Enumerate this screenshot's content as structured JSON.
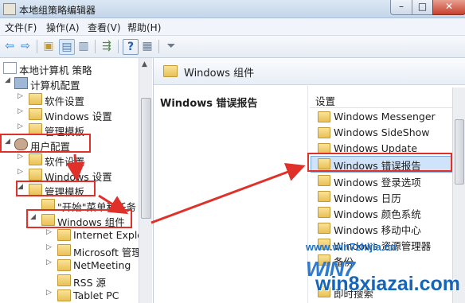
{
  "window": {
    "title": "本地组策略编辑器",
    "buttons": {
      "minimize": "–",
      "maximize": "□",
      "close": "✕"
    }
  },
  "menu": [
    "文件(F)",
    "操作(A)",
    "查看(V)",
    "帮助(H)"
  ],
  "tree": {
    "items": [
      {
        "label": "本地计算机 策略",
        "icon": "document-icon",
        "twisty": ""
      },
      {
        "label": "计算机配置",
        "icon": "computer-icon",
        "twisty": "◢"
      },
      {
        "label": "软件设置",
        "icon": "folder-icon",
        "twisty": "▷"
      },
      {
        "label": "Windows 设置",
        "icon": "folder-icon",
        "twisty": "▷"
      },
      {
        "label": "管理模板",
        "icon": "folder-icon",
        "twisty": "▷"
      },
      {
        "label": "用户配置",
        "icon": "user-icon",
        "twisty": "◢"
      },
      {
        "label": "软件设置",
        "icon": "folder-icon",
        "twisty": "▷"
      },
      {
        "label": "Windows 设置",
        "icon": "folder-icon",
        "twisty": "▷"
      },
      {
        "label": "管理模板",
        "icon": "folder-icon",
        "twisty": "◢"
      },
      {
        "label": "\"开始\"菜单和任务",
        "icon": "folder-icon",
        "twisty": ""
      },
      {
        "label": "Windows 组件",
        "icon": "folder-icon",
        "twisty": "◢"
      },
      {
        "label": "Internet Explor",
        "icon": "folder-icon",
        "twisty": "▷"
      },
      {
        "label": "Microsoft 管理",
        "icon": "folder-icon",
        "twisty": "▷"
      },
      {
        "label": "NetMeeting",
        "icon": "folder-icon",
        "twisty": "▷"
      },
      {
        "label": "RSS 源",
        "icon": "folder-icon",
        "twisty": ""
      },
      {
        "label": "Tablet PC",
        "icon": "folder-icon",
        "twisty": "▷"
      }
    ]
  },
  "right": {
    "header": "Windows 组件",
    "section_title": "Windows 错误报告",
    "column_header": "设置",
    "items": [
      "Windows Messenger",
      "Windows SideShow",
      "Windows Update",
      "Windows 错误报告",
      "Windows 登录选项",
      "Windows 日历",
      "Windows 颜色系统",
      "Windows 移动中心",
      "Windows 资源管理器",
      "备份",
      "",
      "",
      "即时搜索"
    ],
    "selected_index": 3
  },
  "watermark": {
    "site1": "www.win7zhijia.cn",
    "site2": "win8xiazai.com",
    "logo": "WIN7"
  },
  "colors": {
    "highlight": "#e0302a",
    "selection": "#cfe4fa"
  }
}
